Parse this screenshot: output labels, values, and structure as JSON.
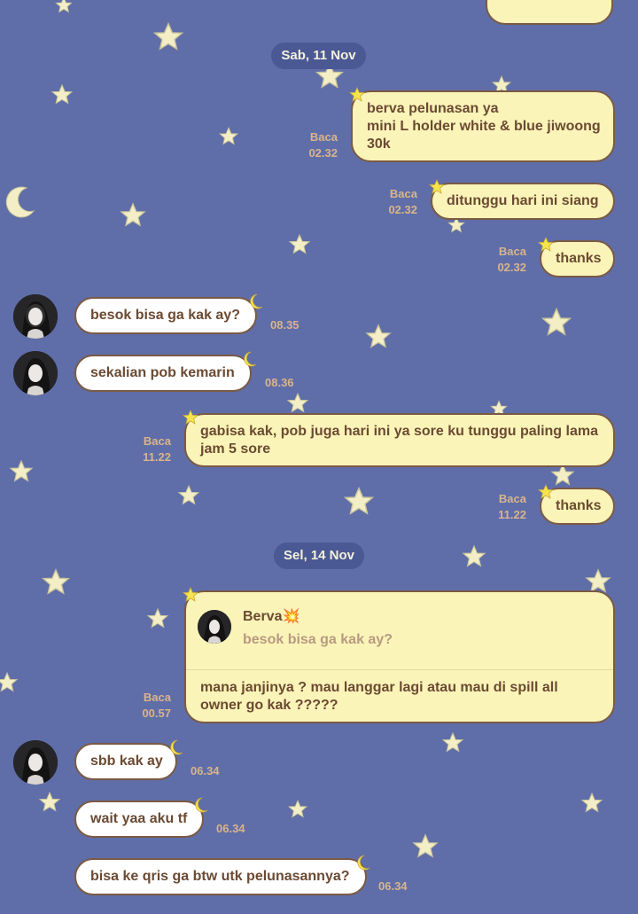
{
  "chat": {
    "date_separators": [
      {
        "label": "Sab, 11 Nov"
      },
      {
        "label": "Sel, 14 Nov"
      }
    ],
    "messages": [
      {
        "direction": "out",
        "lines": [
          "berva pelunasan ya",
          "mini L holder white & blue jiwoong",
          "30k"
        ],
        "status": "Baca",
        "time": "02.32"
      },
      {
        "direction": "out",
        "lines": [
          "ditunggu hari ini siang"
        ],
        "status": "Baca",
        "time": "02.32"
      },
      {
        "direction": "out",
        "lines": [
          "thanks"
        ],
        "status": "Baca",
        "time": "02.32"
      },
      {
        "direction": "in",
        "lines": [
          "besok bisa ga kak ay?"
        ],
        "time": "08.35"
      },
      {
        "direction": "in",
        "lines": [
          "sekalian pob kemarin"
        ],
        "time": "08.36"
      },
      {
        "direction": "out",
        "lines": [
          "gabisa kak, pob juga hari ini ya sore ku tunggu paling lama",
          "jam 5 sore"
        ],
        "status": "Baca",
        "time": "11.22"
      },
      {
        "direction": "out",
        "lines": [
          "thanks"
        ],
        "status": "Baca",
        "time": "11.22"
      },
      {
        "direction": "out",
        "quote": {
          "sender": "Berva💥",
          "text": "besok bisa ga kak ay?"
        },
        "lines": [
          "mana janjinya ? mau langgar lagi atau mau di spill all",
          "owner go kak ?????"
        ],
        "status": "Baca",
        "time": "00.57"
      },
      {
        "direction": "in",
        "lines": [
          "sbb kak ay"
        ],
        "time": "06.34"
      },
      {
        "direction": "in",
        "lines": [
          "wait yaa aku tf"
        ],
        "time": "06.34"
      },
      {
        "direction": "in",
        "lines": [
          "bisa ke qris ga btw utk pelunasannya?"
        ],
        "time": "06.34"
      }
    ]
  },
  "colors": {
    "background": "#5f6ea8",
    "date_pill": "#4a5894",
    "outgoing_bubble": "#fbf4b8",
    "incoming_bubble": "#ffffff",
    "bubble_text": "#6b4a33",
    "meta_text": "#d9b48c"
  },
  "icons": [
    "star-icon",
    "crescent-moon-icon",
    "avatar-photo"
  ]
}
